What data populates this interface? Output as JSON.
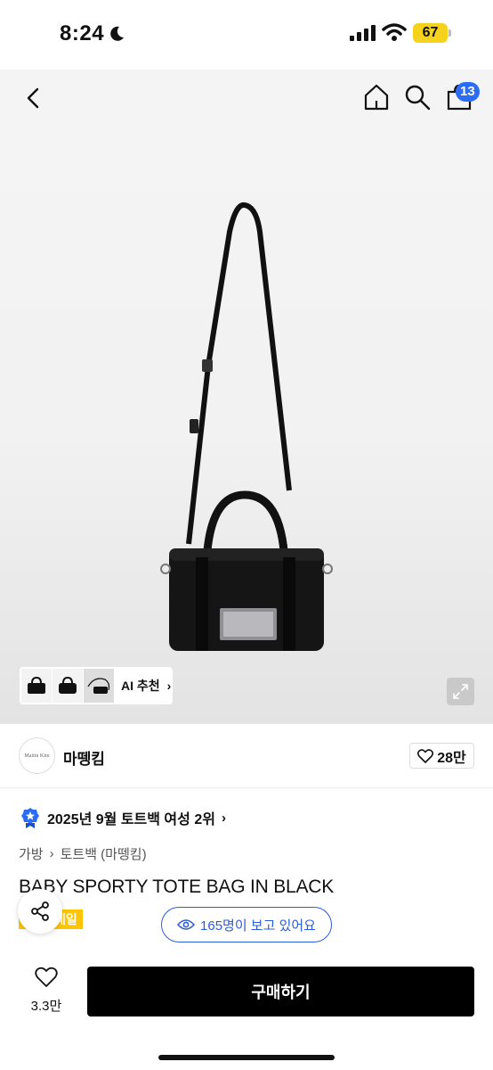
{
  "status_bar": {
    "time": "8:24",
    "battery": "67"
  },
  "nav": {
    "cart_count": "13"
  },
  "gallery": {
    "ai_label": "AI 추천",
    "thumbnails": [
      "bag-front",
      "bag-angle",
      "bag-strap"
    ]
  },
  "brand": {
    "logo_text": "Maitin  Kim",
    "name": "마뗑킴",
    "likes": "28만"
  },
  "ranking": {
    "text": "2025년 9월 토트백 여성 2위"
  },
  "breadcrumb": {
    "items": [
      "가방",
      "토트백 (마뗑킴)"
    ]
  },
  "product": {
    "title": "BABY SPORTY TOTE BAG IN BLACK",
    "badge": "세일"
  },
  "viewers": {
    "text": "165명이 보고 있어요"
  },
  "bottom": {
    "wish_count": "3.3만",
    "buy_label": "구매하기"
  },
  "colors": {
    "accent_blue": "#2b5bd8",
    "badge_blue": "#2b6cf6",
    "sale_yellow": "#ffc400",
    "buy_black": "#000000"
  }
}
